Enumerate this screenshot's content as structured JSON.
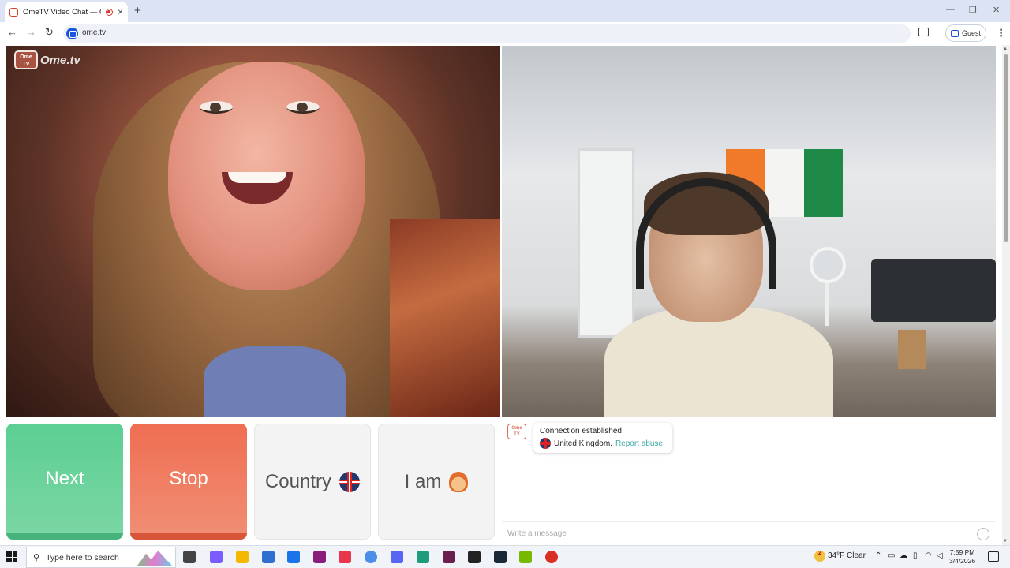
{
  "browser": {
    "tab_title": "OmeTV Video Chat — Ome",
    "tab_close": "×",
    "new_tab": "+",
    "url": "ome.tv",
    "profile_label": "Guest",
    "window_controls": [
      "—",
      "❐",
      "✕"
    ],
    "nav": [
      "←",
      "→",
      "↻"
    ],
    "menu": "⋮"
  },
  "logo": {
    "badge": "Ome TV",
    "text": "Ome.tv"
  },
  "buttons": {
    "next": "Next",
    "stop": "Stop",
    "country": "Country",
    "i_am": "I am"
  },
  "chat": {
    "logo": "Ome TV",
    "status": "Connection established.",
    "country": "United Kingdom.",
    "report": "Report abuse.",
    "placeholder": "Write a message"
  },
  "taskbar": {
    "search_placeholder": "Type here to search",
    "weather_temp": "34°F",
    "weather_desc": "Clear",
    "weather_badge": "2",
    "time": "7:59 PM",
    "date": "3/4/2026",
    "app_icons": [
      "task-view-icon",
      "copilot-icon",
      "file-explorer-icon",
      "store-icon",
      "outlook-icon",
      "next-icon",
      "music-icon",
      "chrome-icon",
      "discord-icon",
      "app-icon",
      "pdf-icon",
      "epic-icon",
      "steam-icon",
      "nvidia-icon",
      "chrome-active-icon"
    ],
    "app_colors": [
      "#444444",
      "#7a5cff",
      "#f5b800",
      "#2f6fd0",
      "#1a73e8",
      "#8a1c7c",
      "#e8364c",
      "#4a8ee8",
      "#5865f2",
      "#1c9c7a",
      "#6b1f4f",
      "#222222",
      "#1b2838",
      "#76b900",
      "#d93025"
    ]
  },
  "colors": {
    "next": "#5ccf93",
    "stop": "#ef6e52",
    "link": "#3aa6a0"
  }
}
